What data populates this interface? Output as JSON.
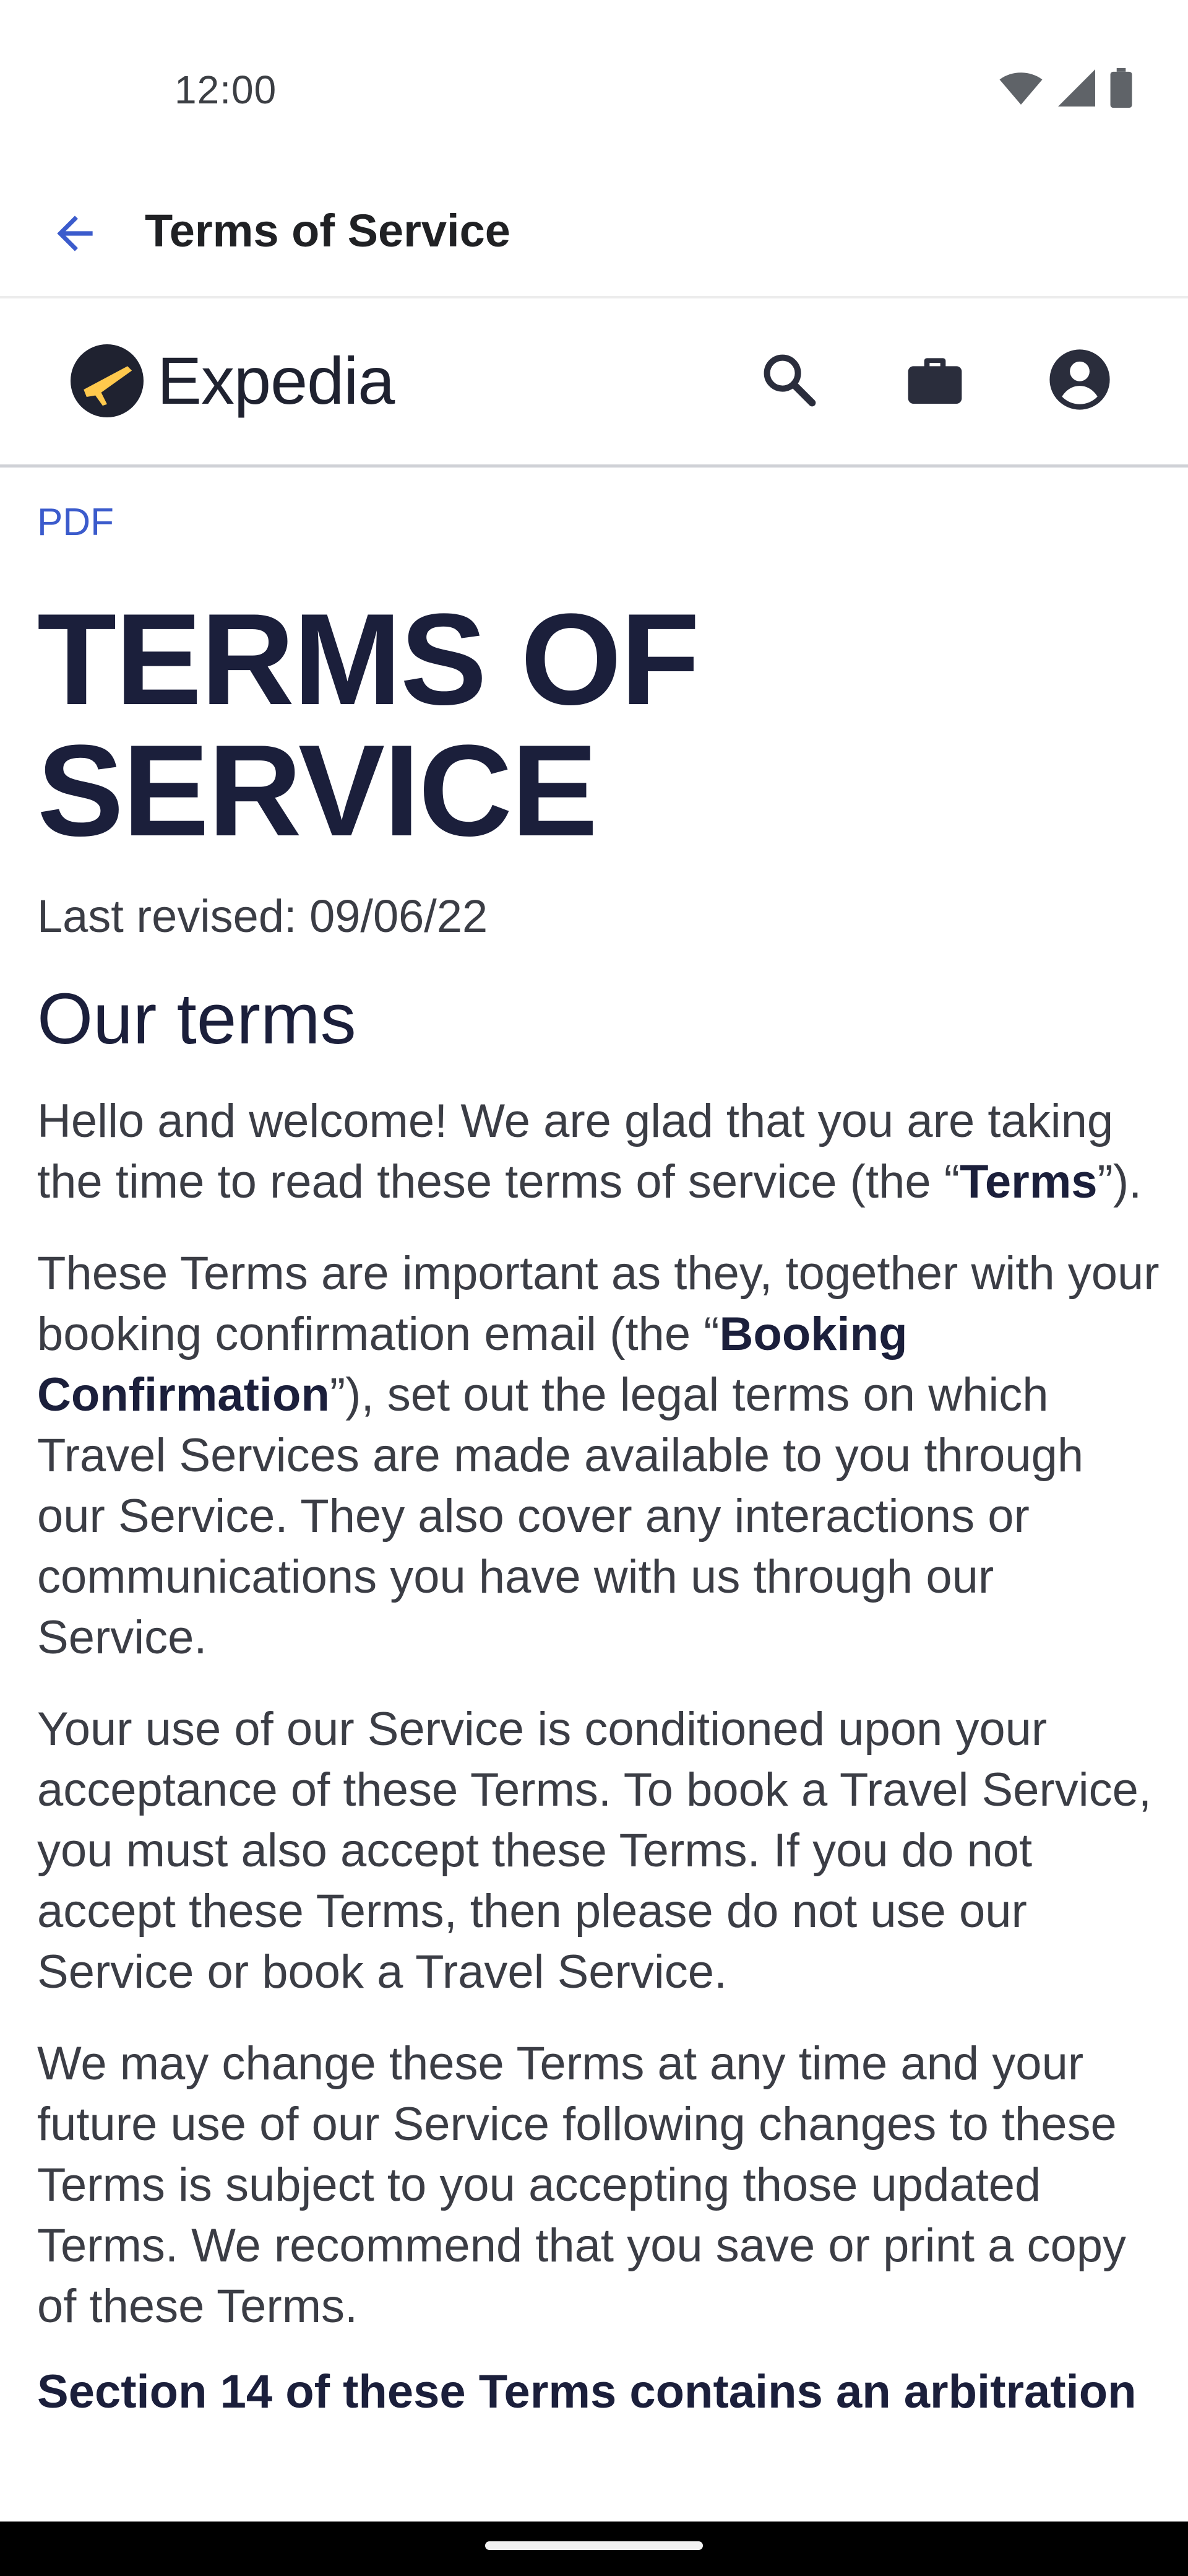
{
  "status_bar": {
    "time": "12:00",
    "icons": [
      "wifi-icon",
      "signal-icon",
      "battery-icon"
    ]
  },
  "app_bar": {
    "title": "Terms of Service",
    "back_icon": "arrow-left-icon"
  },
  "site_header": {
    "logo_text": "Expedia",
    "actions": [
      "search-icon",
      "briefcase-icon",
      "account-icon"
    ],
    "colors": {
      "logo_circle": "#1f2230",
      "logo_plane": "#ffc94d"
    }
  },
  "content": {
    "pdf_link": "PDF",
    "heading_line1": "TERMS OF",
    "heading_line2": "SERVICE",
    "last_revised": "Last revised: 09/06/22",
    "section_title": "Our terms",
    "p1": {
      "t1": "Hello and welcome! We are glad that you are taking the time to read these terms of service (the “",
      "b1": "Terms",
      "t2": "”)."
    },
    "p2": {
      "t1": "These Terms are important as they, together with your booking confirmation email (the “",
      "b1": "Booking Confirmation",
      "t2": "”), set out the legal terms on which Travel Services are made available to you through our Service. They also cover any interactions or communications you have with us through our Service."
    },
    "p3": "Your use of our Service is conditioned upon your acceptance of these Terms. To book a Travel Service, you must also accept these Terms. If you do not accept these Terms, then please do not use our Service or book a Travel Service.",
    "p4": "We may change these Terms at any time and your future use of our Service following changes to these Terms is subject to you accepting those updated Terms. We recommend that you save or print a copy of these Terms.",
    "p5_partial": "Section 14 of these Terms contains an arbitration"
  },
  "theme": {
    "accent": "#3b5bcc",
    "heading": "#1b1f3b",
    "body_text": "#3b3d45"
  }
}
